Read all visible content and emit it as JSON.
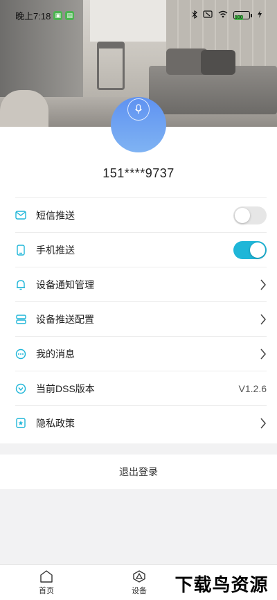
{
  "status_bar": {
    "time": "晚上7:18",
    "battery": "100"
  },
  "profile": {
    "phone": "151****9737"
  },
  "settings": [
    {
      "label": "短信推送",
      "type": "toggle",
      "on": false,
      "icon": "mail-icon"
    },
    {
      "label": "手机推送",
      "type": "toggle",
      "on": true,
      "icon": "phone-icon"
    },
    {
      "label": "设备通知管理",
      "type": "chevron",
      "icon": "bell-icon"
    },
    {
      "label": "设备推送配置",
      "type": "chevron",
      "icon": "server-icon"
    },
    {
      "label": "我的消息",
      "type": "chevron",
      "icon": "message-icon"
    },
    {
      "label": "当前DSS版本",
      "type": "value",
      "value": "V1.2.6",
      "icon": "version-icon"
    },
    {
      "label": "隐私政策",
      "type": "chevron",
      "icon": "star-shield-icon"
    }
  ],
  "logout_label": "退出登录",
  "tabbar": {
    "home_label": "首页",
    "device_label": "设备"
  },
  "watermark": "下载鸟资源",
  "colors": {
    "accent": "#1fb6d8",
    "avatar": "#6b9ef2"
  }
}
